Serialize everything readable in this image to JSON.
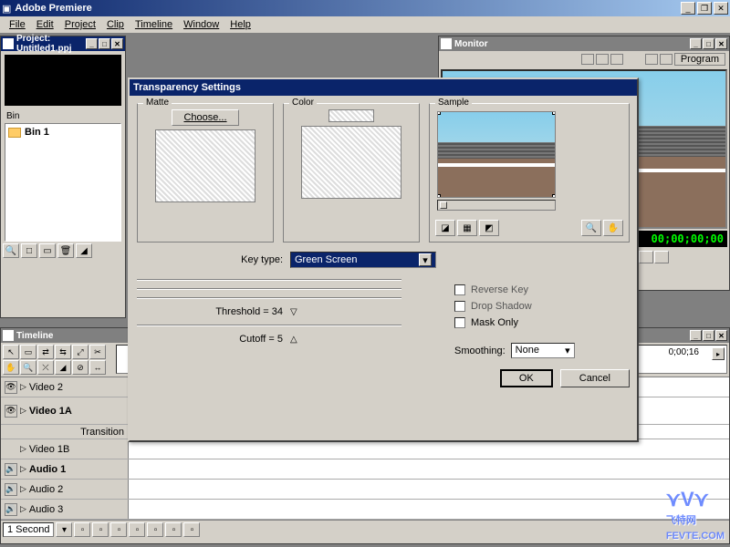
{
  "app": {
    "title": "Adobe Premiere"
  },
  "menu": [
    "File",
    "Edit",
    "Project",
    "Clip",
    "Timeline",
    "Window",
    "Help"
  ],
  "project": {
    "title": "Project: Untitled1.ppj",
    "bin_header": "Bin",
    "bins": [
      "Bin 1"
    ]
  },
  "monitor": {
    "title": "Monitor",
    "tab_label": "Program",
    "timecode": "00;00;00;00"
  },
  "timeline": {
    "title": "Timeline",
    "time_label": "0;00;16",
    "tracks": [
      {
        "name": "Video 2",
        "kind": "video"
      },
      {
        "name": "Video 1A",
        "kind": "video",
        "bold": true
      },
      {
        "name": "Transition",
        "kind": "transition"
      },
      {
        "name": "Video 1B",
        "kind": "video"
      },
      {
        "name": "Audio 1",
        "kind": "audio",
        "bold": true
      },
      {
        "name": "Audio 2",
        "kind": "audio"
      },
      {
        "name": "Audio 3",
        "kind": "audio"
      }
    ],
    "zoom": "1 Second"
  },
  "dialog": {
    "title": "Transparency Settings",
    "matte_label": "Matte",
    "choose_label": "Choose...",
    "color_label": "Color",
    "sample_label": "Sample",
    "keytype_label": "Key type:",
    "keytype_value": "Green Screen",
    "threshold_label": "Threshold = 34",
    "threshold_value": 34,
    "cutoff_label": "Cutoff = 5",
    "cutoff_value": 5,
    "reverse_key": "Reverse Key",
    "drop_shadow": "Drop Shadow",
    "mask_only": "Mask Only",
    "smoothing_label": "Smoothing:",
    "smoothing_value": "None",
    "ok": "OK",
    "cancel": "Cancel"
  },
  "watermark": "飞特网\nFEVTE.COM"
}
